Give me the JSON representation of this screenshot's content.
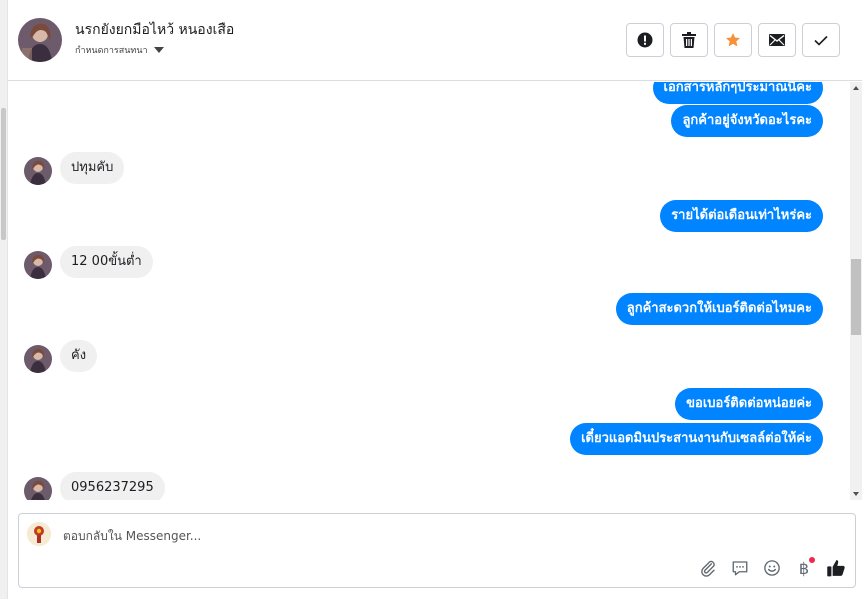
{
  "header": {
    "contact_name": "นรกยังยกมือไหว้ หนองเสือ",
    "status_label": "กำหนดการสนทนา",
    "actions": [
      "spam-icon",
      "trash-icon",
      "star-icon",
      "mail-icon",
      "check-icon"
    ],
    "star_color": "#f7923a"
  },
  "messages": [
    {
      "dir": "out",
      "text": "เอกสารหลักๆประมาณนี้คะ"
    },
    {
      "dir": "out",
      "text": "ลูกค้าอยู่จังหวัดอะไรคะ"
    },
    {
      "dir": "in",
      "text": "ปทุมคับ"
    },
    {
      "dir": "out",
      "text": "รายได้ต่อเดือนเท่าไหร่คะ"
    },
    {
      "dir": "in",
      "text": "12 00ขั้นต่ำ"
    },
    {
      "dir": "out",
      "text": "ลูกค้าสะดวกให้เบอร์ติดต่อไหมคะ"
    },
    {
      "dir": "in",
      "text": "คัง"
    },
    {
      "dir": "out",
      "text": "ขอเบอร์ติดต่อหน่อยค่ะ"
    },
    {
      "dir": "out",
      "text": "เดี๋ยวแอดมินประสานงานกับเซลล์ต่อให้ค่ะ"
    },
    {
      "dir": "in",
      "text": "0956237295"
    }
  ],
  "composer": {
    "placeholder": "ตอบกลับใน Messenger...",
    "tools": [
      "attachment-icon",
      "saved-reply-icon",
      "emoji-icon",
      "baht-payment-icon",
      "like-icon"
    ],
    "currency_symbol": "฿"
  },
  "colors": {
    "outgoing_bubble": "#0084ff",
    "incoming_bubble": "#f0f0f0",
    "notification_dot": "#f02849"
  }
}
